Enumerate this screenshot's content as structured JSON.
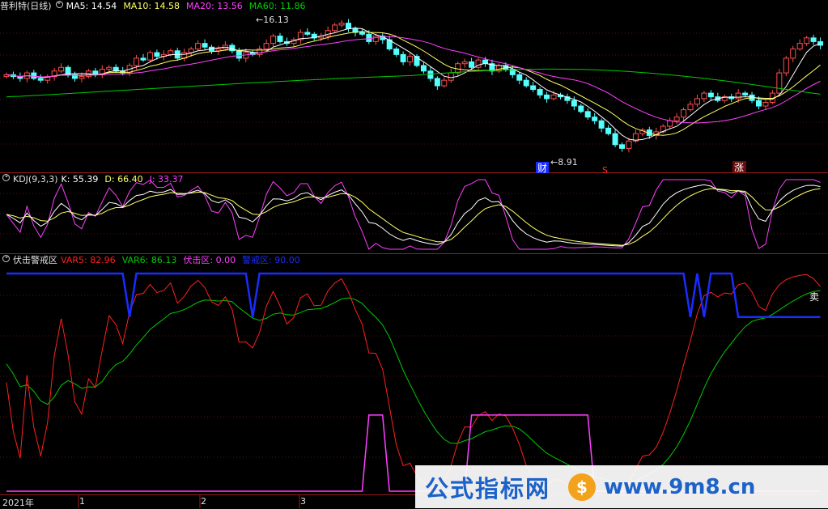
{
  "panel1": {
    "title": "普利特(日线)",
    "ma5": "MA5: 14.54",
    "ma10": "MA10: 14.58",
    "ma20": "MA20: 13.56",
    "ma60": "MA60: 11.86",
    "high_label": "16.13",
    "low_label": "8.91",
    "marker_cai": "财",
    "marker_s": "S",
    "marker_zhang": "涨"
  },
  "panel2": {
    "title": "KDJ(9,3,3)",
    "k": "K: 55.39",
    "d": "D: 66.40",
    "j": "J: 33.37"
  },
  "panel3": {
    "title": "伏击警戒区",
    "var5": "VAR5: 82.96",
    "var6": "VAR6: 86.13",
    "fuji": "伏击区: 0.00",
    "jingjie": "警戒区: 90.00",
    "sell": "卖"
  },
  "xaxis": [
    "2021年",
    "1",
    "2",
    "3"
  ],
  "watermark": {
    "text1": "公式指标网",
    "logo": "$",
    "text2": "www.9m8.cn"
  },
  "colors": {
    "up": "#ff4d4d",
    "down": "#54ffff",
    "ma5": "#ffffff",
    "ma10": "#ffff66",
    "ma20": "#ff40ff",
    "ma60": "#00cc00",
    "var5": "#ff2020",
    "var6": "#00cc00",
    "fuji": "#ff40ff",
    "jingjie": "#1a2cff"
  },
  "chart_data": {
    "type": "candlestick",
    "n_bars": 120,
    "price_high": 16.13,
    "price_low": 8.91,
    "ma_last": {
      "MA5": 14.54,
      "MA10": 14.58,
      "MA20": 13.56,
      "MA60": 11.86
    },
    "close": [
      13.2,
      13.1,
      13.0,
      13.3,
      13.0,
      12.9,
      13.1,
      13.4,
      13.6,
      13.2,
      13.0,
      13.1,
      13.4,
      13.2,
      13.5,
      13.6,
      13.4,
      13.3,
      13.7,
      14.1,
      14.0,
      14.4,
      14.2,
      14.3,
      14.5,
      14.1,
      14.4,
      14.6,
      14.9,
      14.7,
      14.5,
      14.6,
      14.8,
      14.5,
      14.1,
      14.4,
      14.3,
      14.6,
      14.9,
      15.3,
      15.0,
      14.9,
      15.1,
      15.5,
      15.4,
      15.2,
      15.3,
      15.6,
      15.9,
      16.0,
      15.7,
      15.5,
      15.4,
      15.0,
      15.3,
      15.1,
      14.6,
      14.3,
      13.9,
      14.2,
      13.7,
      13.4,
      13.0,
      12.6,
      12.9,
      13.3,
      13.8,
      13.9,
      13.6,
      14.0,
      13.8,
      13.4,
      13.7,
      13.5,
      13.2,
      12.9,
      12.6,
      12.4,
      12.1,
      11.9,
      12.1,
      12.0,
      11.8,
      11.5,
      11.2,
      10.9,
      10.7,
      10.3,
      10.0,
      9.4,
      9.2,
      9.6,
      10.0,
      10.2,
      9.9,
      10.1,
      10.4,
      10.7,
      10.9,
      11.3,
      11.6,
      11.9,
      12.2,
      12.0,
      11.8,
      12.0,
      11.9,
      12.2,
      12.1,
      11.8,
      11.5,
      11.7,
      12.2,
      13.3,
      14.1,
      14.6,
      14.9,
      15.2,
      15.0,
      14.8
    ],
    "kdj": {
      "K": 55.39,
      "D": 66.4,
      "J": 33.37
    },
    "fuji_values": {
      "VAR5": 82.96,
      "VAR6": 86.13,
      "伏击区": 0.0,
      "警戒区": 90.0
    }
  }
}
